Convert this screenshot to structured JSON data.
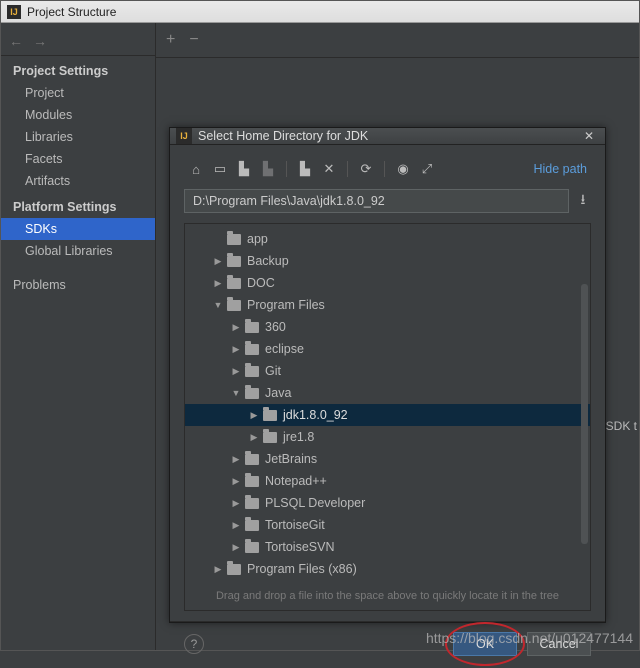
{
  "window": {
    "title": "Project Structure"
  },
  "sidebar": {
    "project_settings_header": "Project Settings",
    "project": "Project",
    "modules": "Modules",
    "libraries": "Libraries",
    "facets": "Facets",
    "artifacts": "Artifacts",
    "platform_settings_header": "Platform Settings",
    "sdks": "SDKs",
    "global_libraries": "Global Libraries",
    "problems": "Problems"
  },
  "content": {
    "sdk_label": "SDK t"
  },
  "dialog": {
    "title": "Select Home Directory for JDK",
    "hide_path": "Hide path",
    "path_value": "D:\\Program Files\\Java\\jdk1.8.0_92",
    "hint": "Drag and drop a file into the space above to quickly locate it in the tree",
    "ok": "OK",
    "cancel": "Cancel",
    "tree": [
      {
        "indent": 1,
        "expanded": null,
        "label": "app"
      },
      {
        "indent": 1,
        "expanded": false,
        "label": "Backup"
      },
      {
        "indent": 1,
        "expanded": false,
        "label": "DOC"
      },
      {
        "indent": 1,
        "expanded": true,
        "label": "Program Files"
      },
      {
        "indent": 2,
        "expanded": false,
        "label": "360"
      },
      {
        "indent": 2,
        "expanded": false,
        "label": "eclipse"
      },
      {
        "indent": 2,
        "expanded": false,
        "label": "Git"
      },
      {
        "indent": 2,
        "expanded": true,
        "label": "Java"
      },
      {
        "indent": 3,
        "expanded": false,
        "label": "jdk1.8.0_92",
        "selected": true
      },
      {
        "indent": 3,
        "expanded": false,
        "label": "jre1.8"
      },
      {
        "indent": 2,
        "expanded": false,
        "label": "JetBrains"
      },
      {
        "indent": 2,
        "expanded": false,
        "label": "Notepad++"
      },
      {
        "indent": 2,
        "expanded": false,
        "label": "PLSQL Developer"
      },
      {
        "indent": 2,
        "expanded": false,
        "label": "TortoiseGit"
      },
      {
        "indent": 2,
        "expanded": false,
        "label": "TortoiseSVN"
      },
      {
        "indent": 1,
        "expanded": false,
        "label": "Program Files (x86)"
      }
    ]
  },
  "watermark": "https://blog.csdn.net/u012477144"
}
